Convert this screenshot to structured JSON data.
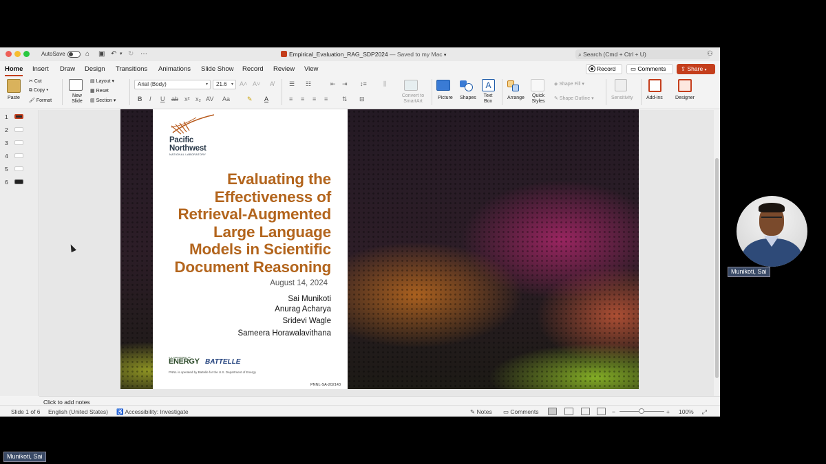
{
  "window": {
    "autosave_label": "AutoSave",
    "doc_name": "Empirical_Evaluation_RAG_SDP2024",
    "saved_status": "— Saved to my Mac",
    "search_placeholder": "Search (Cmd + Ctrl + U)"
  },
  "ribbon_tabs": [
    "Home",
    "Insert",
    "Draw",
    "Design",
    "Transitions",
    "Animations",
    "Slide Show",
    "Record",
    "Review",
    "View"
  ],
  "ribbon_right": {
    "record": "Record",
    "comments": "Comments",
    "share": "Share"
  },
  "ribbon": {
    "paste": "Paste",
    "cut": "Cut",
    "copy": "Copy",
    "format": "Format",
    "new_slide": "New Slide",
    "layout": "Layout",
    "reset": "Reset",
    "section": "Section",
    "font": "Arial (Body)",
    "size": "21.6",
    "convert_smartart": "Convert to SmartArt",
    "picture": "Picture",
    "shapes": "Shapes",
    "text_box": "Text Box",
    "arrange": "Arrange",
    "quick_styles": "Quick Styles",
    "shape_fill": "Shape Fill",
    "shape_outline": "Shape Outline",
    "sensitivity": "Sensitivity",
    "addins": "Add-ins",
    "designer": "Designer"
  },
  "thumbnails": [
    "1",
    "2",
    "3",
    "4",
    "5",
    "6"
  ],
  "slide": {
    "org_line1": "Pacific",
    "org_line2": "Northwest",
    "org_sub": "NATIONAL LABORATORY",
    "title_lines": [
      "Evaluating the",
      "Effectiveness of",
      "Retrieval-Augmented",
      "Large Language",
      "Models in Scientific",
      "Document Reasoning"
    ],
    "date": "August 14, 2024",
    "authors": [
      "Sai Munikoti",
      "Anurag Acharya",
      "Sridevi Wagle",
      "Sameera Horawalavithana"
    ],
    "doe_small": "U.S. DEPARTMENT OF",
    "energy": "ENERGY",
    "battelle": "BATTELLE",
    "footnote": "PNNL is operated by Battelle for the U.S. Department of Energy",
    "code": "PNNL-SA-202143"
  },
  "notes_placeholder": "Click to add notes",
  "status": {
    "slide_of": "Slide 1 of 6",
    "language": "English (United States)",
    "accessibility": "Accessibility: Investigate",
    "notes": "Notes",
    "comments": "Comments",
    "zoom": "100%"
  },
  "participant": {
    "name": "Munikoti, Sai"
  },
  "colors": {
    "accent": "#c43e1c",
    "title": "#b3651d"
  }
}
